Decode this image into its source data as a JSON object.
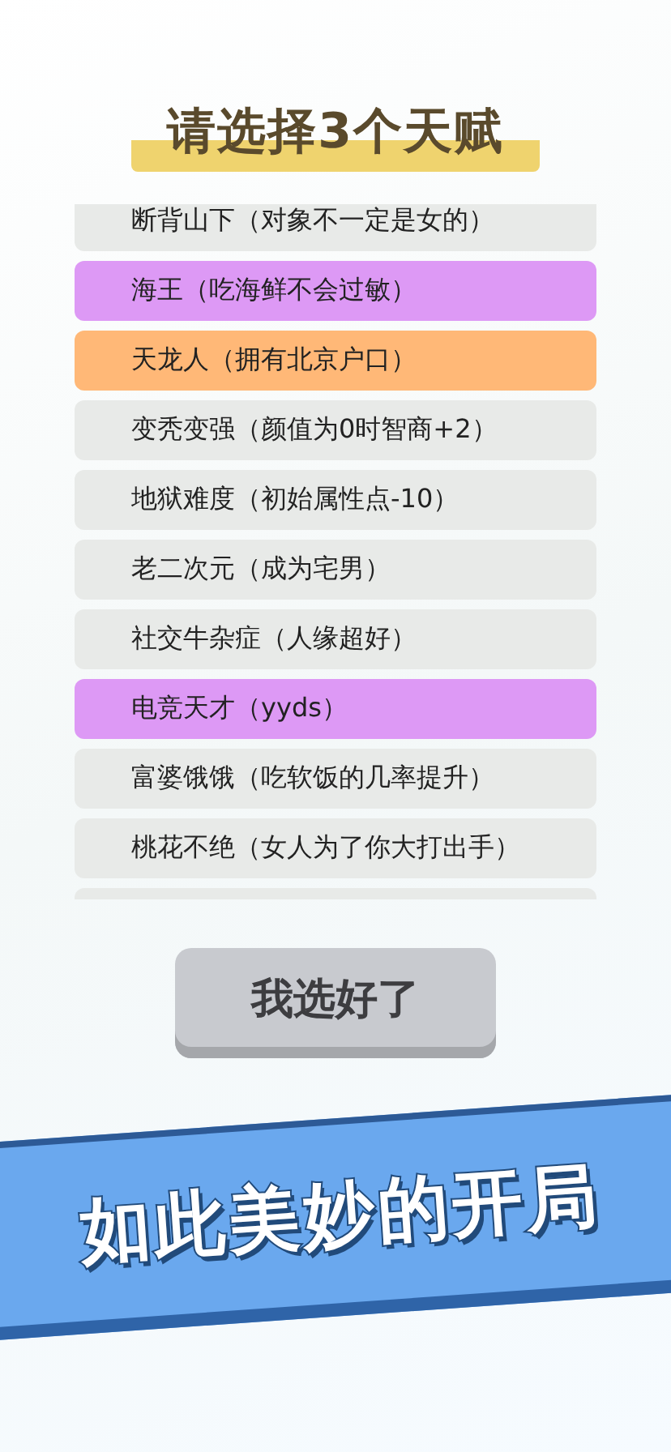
{
  "title": "请选择3个天赋",
  "talents": [
    {
      "label": "断背山下（对象不一定是女的）",
      "color": "#e8eae8"
    },
    {
      "label": "海王（吃海鲜不会过敏）",
      "color": "#dd99f5"
    },
    {
      "label": "天龙人（拥有北京户口）",
      "color": "#ffb877"
    },
    {
      "label": "变秃变强（颜值为0时智商+2）",
      "color": "#e8eae8"
    },
    {
      "label": "地狱难度（初始属性点-10）",
      "color": "#e8eae8"
    },
    {
      "label": "老二次元（成为宅男）",
      "color": "#e8eae8"
    },
    {
      "label": "社交牛杂症（人缘超好）",
      "color": "#e8eae8"
    },
    {
      "label": "电竞天才（yyds）",
      "color": "#dd99f5"
    },
    {
      "label": "富婆饿饿（吃软饭的几率提升）",
      "color": "#e8eae8"
    },
    {
      "label": "桃花不绝（女人为了你大打出手）",
      "color": "#e8eae8"
    }
  ],
  "confirm_button": "我选好了",
  "banner": "如此美妙的开局"
}
